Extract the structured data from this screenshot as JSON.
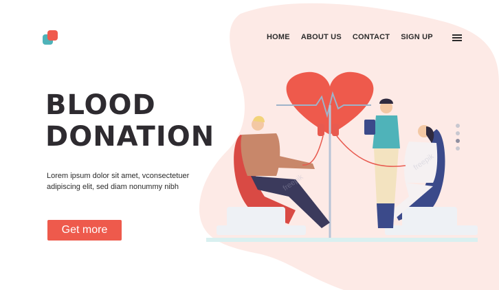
{
  "brand": {
    "logo_colors": [
      "#4fb3b9",
      "#ef5b4e"
    ]
  },
  "nav": {
    "items": [
      "HOME",
      "ABOUT US",
      "CONTACT",
      "SIGN UP"
    ],
    "menu_icon": "hamburger-icon"
  },
  "hero": {
    "title_line1": "BLOOD",
    "title_line2": "DONATION",
    "body": "Lorem ipsum dolor sit amet, vconsectetuer adipiscing elit, sed diam nonummy nibh",
    "cta_label": "Get more"
  },
  "carousel": {
    "dots": 4,
    "active_index": 2
  },
  "watermark": "freepik",
  "colors": {
    "accent": "#ee5a4c",
    "blob": "#fde8e4",
    "heart": "#ee5a4c",
    "text": "#2e2b30"
  }
}
